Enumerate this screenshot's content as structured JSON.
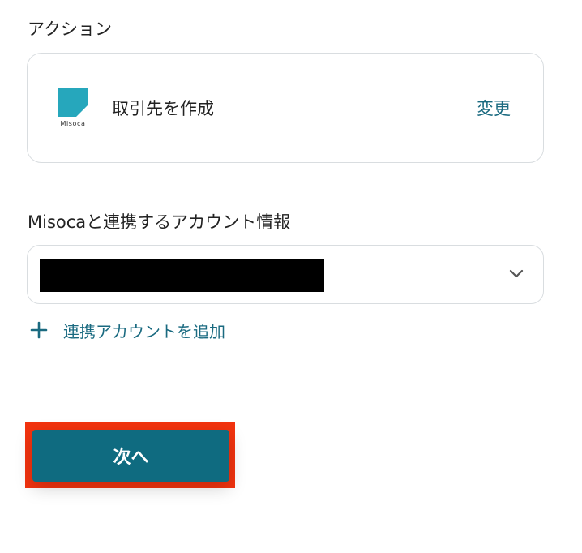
{
  "action": {
    "title": "アクション",
    "app_logo_text": "Misoca",
    "name": "取引先を作成",
    "change_label": "変更"
  },
  "account": {
    "title": "Misocaと連携するアカウント情報",
    "selected_value": "",
    "add_label": "連携アカウントを追加"
  },
  "footer": {
    "next_label": "次へ"
  },
  "colors": {
    "accent": "#1a6a80",
    "primary_button": "#0f6b80",
    "highlight": "#f2330f",
    "logo": "#26a7bc"
  }
}
